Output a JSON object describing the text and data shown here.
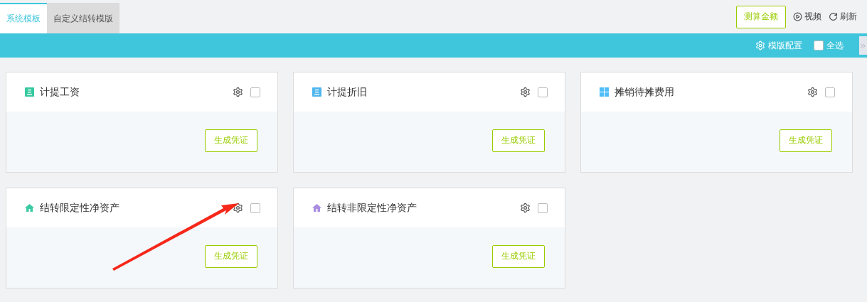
{
  "tabs": [
    {
      "label": "系统模板",
      "selected": true
    },
    {
      "label": "自定义结转模版",
      "selected": false
    }
  ],
  "actions": {
    "estimate_button": "测算金额",
    "video_link": "视频",
    "refresh_link": "刷新"
  },
  "toolbar": {
    "config_link": "模版配置",
    "select_all": {
      "label": "全选",
      "checked": false
    }
  },
  "cards": [
    {
      "title": "计提工资",
      "kind": "badge",
      "color": "#36c9a0",
      "checked": false,
      "button": "生成凭证"
    },
    {
      "title": "计提折旧",
      "kind": "badge",
      "color": "#4fb6ee",
      "checked": false,
      "button": "生成凭证"
    },
    {
      "title": "摊销待摊费用",
      "kind": "grid",
      "color": "#4fbdf7",
      "checked": false,
      "button": "生成凭证"
    },
    {
      "title": "结转限定性净资产",
      "kind": "house",
      "color": "#3ccaa4",
      "checked": false,
      "button": "生成凭证"
    },
    {
      "title": "结转非限定性净资产",
      "kind": "house",
      "color": "#a98ee0",
      "checked": false,
      "button": "生成凭证"
    }
  ],
  "annotations": [
    {
      "kind": "arrow"
    }
  ]
}
